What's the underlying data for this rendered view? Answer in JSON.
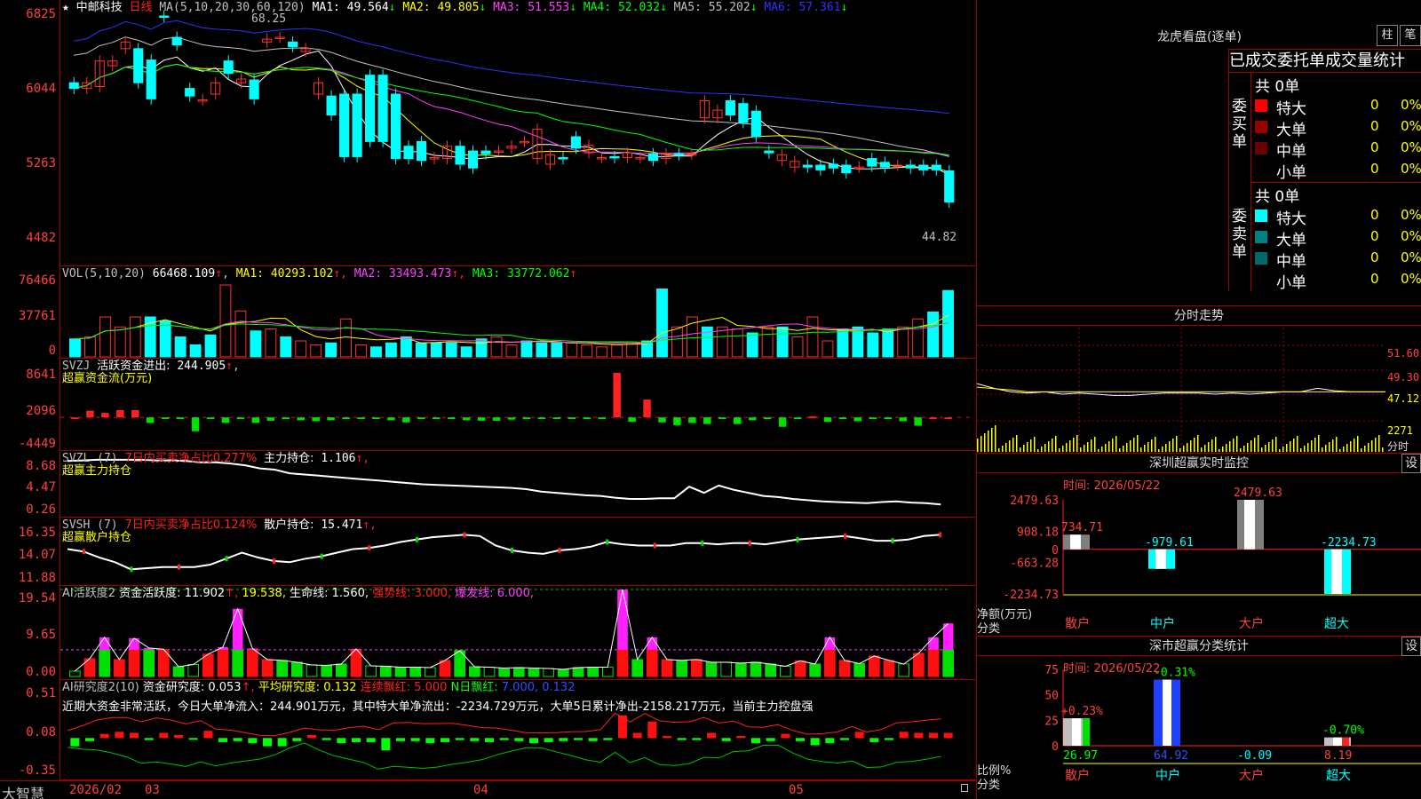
{
  "main": {
    "stock_name": "中邮科技",
    "period": "日线",
    "ma_params": "MA(5,10,20,30,60,120)",
    "ma": [
      {
        "label": "MA1:",
        "value": "49.564",
        "arrow": "↓",
        "color": "#ffffff"
      },
      {
        "label": "MA2:",
        "value": "49.805",
        "arrow": "↓",
        "color": "#ffff00"
      },
      {
        "label": "MA3:",
        "value": "51.553",
        "arrow": "↓",
        "color": "#ff40ff"
      },
      {
        "label": "MA4:",
        "value": "52.032",
        "arrow": "↓",
        "color": "#00ff00"
      },
      {
        "label": "MA5:",
        "value": "55.202",
        "arrow": "↓",
        "color": "#c0c0c0"
      },
      {
        "label": "MA6:",
        "value": "57.361",
        "arrow": "↓",
        "color": "#3030ff"
      }
    ],
    "y_ticks": [
      "6825",
      "6044",
      "5263",
      "4482"
    ],
    "high_label": "68.25",
    "low_label": "44.82"
  },
  "vol": {
    "header": "VOL(5,10,20)",
    "value": "66468.109",
    "arrow": "↑",
    "ma": [
      {
        "label": "MA1:",
        "value": "40293.102",
        "arrow": "↑",
        "color": "#ffff00"
      },
      {
        "label": "MA2:",
        "value": "33493.473",
        "arrow": "↑",
        "color": "#ff40ff"
      },
      {
        "label": "MA3:",
        "value": "33772.062",
        "arrow": "↑",
        "color": "#00ff00"
      }
    ],
    "y_ticks": [
      "76466",
      "37761",
      "0"
    ]
  },
  "svzj": {
    "header": "SVZJ",
    "label": "活跃资金进出:",
    "value": "244.905",
    "arrow": "↑",
    "sub": "超赢资金流(万元)",
    "y_ticks": [
      "8641",
      "2096",
      "-4449"
    ]
  },
  "svzl": {
    "header": "SVZL (7)",
    "label1": "7日内买卖净占比0.277%",
    "label2": "主力持仓:",
    "value": "1.106",
    "arrow": "↑,",
    "sub": "超赢主力持仓",
    "y_ticks": [
      "8.68",
      "4.47",
      "0.26"
    ]
  },
  "svsh": {
    "header": "SVSH (7)",
    "label1": "7日内买卖净占比0.124%",
    "label2": "散户持仓:",
    "value": "15.471",
    "arrow": "↑,",
    "sub": "超赢散户持仓",
    "y_ticks": [
      "16.35",
      "14.07",
      "11.88"
    ]
  },
  "ai_active": {
    "header": "AI活跃度2",
    "label": "资金活跃度:",
    "value": "11.902",
    "arrow": "↑,",
    "v2": "19.538,",
    "life_label": "生命线:",
    "life_value": "1.560,",
    "strong_label": "强势线:",
    "strong_value": "3.000,",
    "burst_label": "爆发线:",
    "burst_value": "6.000,",
    "y_ticks": [
      "19.54",
      "9.65",
      "0.00"
    ]
  },
  "ai_research": {
    "header": "AI研究度2(10)",
    "label": "资金研究度:",
    "value": "0.053",
    "arrow": "↑,",
    "avg_label": "平均研究度:",
    "avg_value": "0.132",
    "red_label": "连续飘红:",
    "red_value": "5.000",
    "n_label": "N日飘红:",
    "n_value": "7.000, 0.132",
    "note": "近期大资金非常活跃，今日大单净流入：244.901万元，其中特大单净流出：-2234.729万元，大单5日累计净出-2158.217万元，当前主力控盘强",
    "y_ticks": [
      "0.51",
      "0.08",
      "-0.35"
    ]
  },
  "bottom": {
    "brand": "大智慧",
    "dates": [
      "2026/02",
      "03",
      "04",
      "05"
    ]
  },
  "lhb": {
    "title": "龙虎看盘(逐单)",
    "btn1": "柱",
    "btn2": "笔",
    "heading": "已成交委托单成交量统计",
    "buy_label": "委买单",
    "sell_label": "委卖单",
    "buy_total": "共 0单",
    "sell_total": "共 0单",
    "buy_rows": [
      {
        "name": "特大",
        "n": "0",
        "p": "0%",
        "color": "#ff0000"
      },
      {
        "name": "大单",
        "n": "0",
        "p": "0%",
        "color": "#9a0000"
      },
      {
        "name": "中单",
        "n": "0",
        "p": "0%",
        "color": "#6a0000"
      },
      {
        "name": "小单",
        "n": "0",
        "p": "0%",
        "color": ""
      }
    ],
    "sell_rows": [
      {
        "name": "特大",
        "n": "0",
        "p": "0%",
        "color": "#00ffff"
      },
      {
        "name": "大单",
        "n": "0",
        "p": "0%",
        "color": "#008080"
      },
      {
        "name": "中单",
        "n": "0",
        "p": "0%",
        "color": "#006a6a"
      },
      {
        "name": "小单",
        "n": "0",
        "p": "0%",
        "color": ""
      }
    ]
  },
  "intraday": {
    "title": "分时走势",
    "ticks": [
      "51.60",
      "49.30",
      "47.12",
      "2271",
      "分时"
    ]
  },
  "sz_monitor": {
    "title": "深圳超赢实时监控",
    "set": "设",
    "time": "时间: 2026/05/22",
    "y_ticks": [
      "2479.63",
      "908.18",
      "0",
      "-663.28",
      "-2234.73"
    ],
    "ylabel": "净额(万元)",
    "xlabel": "分类",
    "categories": [
      "散户",
      "中户",
      "大户",
      "超大"
    ],
    "values": [
      "734.71",
      "-979.61",
      "2479.63",
      "-2234.73"
    ]
  },
  "sz_class": {
    "title": "深市超赢分类统计",
    "set": "设",
    "time": "时间: 2026/05/22",
    "y_ticks": [
      "75",
      "50",
      "25",
      "0"
    ],
    "ylabel": "比例%",
    "xlabel": "分类",
    "categories": [
      "散户",
      "中户",
      "大户",
      "超大"
    ],
    "bar_labels": [
      "+0.23%",
      "-0.31%",
      "",
      "-0.70%"
    ],
    "values": [
      "26.97",
      "64.92",
      "-0.09",
      "8.19"
    ]
  },
  "chart_data": [
    {
      "type": "candlestick",
      "title": "中邮科技 日线",
      "x_labels": [
        "2026/02",
        "03",
        "04",
        "05"
      ],
      "ylim": [
        44.82,
        68.25
      ],
      "open": [
        61.2,
        60.6,
        60.8,
        63.0,
        64.8,
        64.8,
        63.6,
        68.25,
        66.0,
        60.6,
        59.4,
        60.0,
        63.5,
        61.2,
        61.5,
        65.5,
        66.0,
        65.5,
        64.5,
        60.0,
        59.8,
        60.0,
        60.0,
        62.0,
        62.0,
        60.0,
        54.5,
        55.0,
        53.2,
        53.2,
        54.5,
        54.0,
        54.0,
        54.0,
        54.3,
        55.0,
        53.2,
        52.6,
        53.3,
        55.5,
        53.8,
        53.3,
        53.4,
        53.3,
        53.3,
        53.7,
        53.2,
        53.7,
        53.7,
        57.5,
        57.5,
        59.3,
        59.0,
        58.2,
        54.0,
        53.0,
        52.3,
        52.5,
        52.5,
        52.6,
        52.5,
        52.3,
        53.2,
        52.8,
        52.5,
        52.5,
        52.5,
        52.5,
        51.9
      ],
      "close": [
        60.6,
        61.2,
        63.5,
        63.5,
        65.5,
        61.2,
        59.5,
        68.2,
        65.2,
        59.8,
        59.4,
        61.2,
        62.2,
        61.6,
        59.5,
        65.8,
        66.0,
        65.0,
        64.8,
        61.2,
        57.8,
        53.4,
        53.4,
        55.0,
        55.0,
        53.2,
        53.2,
        53.0,
        53.3,
        54.5,
        52.6,
        52.2,
        53.7,
        54.0,
        54.5,
        55.0,
        56.3,
        53.6,
        53.2,
        54.3,
        54.6,
        53.3,
        53.3,
        53.8,
        53.3,
        53.0,
        53.7,
        53.6,
        53.7,
        59.3,
        58.3,
        57.8,
        57.0,
        55.5,
        53.8,
        53.6,
        52.9,
        52.3,
        52.0,
        52.2,
        51.7,
        52.3,
        52.4,
        52.3,
        52.5,
        52.2,
        52.0,
        52.0,
        48.6
      ]
    },
    {
      "type": "bar",
      "title": "VOL(5,10,20)",
      "ylim": [
        0,
        76466
      ],
      "values": [
        18000,
        20000,
        40000,
        30000,
        40000,
        40000,
        36000,
        20000,
        12000,
        22000,
        72000,
        46000,
        26000,
        28000,
        20000,
        16000,
        12000,
        14000,
        38000,
        12000,
        10000,
        14000,
        20000,
        14000,
        14000,
        14000,
        10000,
        18000,
        20000,
        12000,
        16000,
        14000,
        14000,
        14000,
        12000,
        10000,
        12000,
        15000,
        16000,
        68000,
        30000,
        40000,
        30000,
        30000,
        28000,
        24000,
        30000,
        30000,
        20000,
        40000,
        16000,
        28000,
        30000,
        24000,
        28000,
        30000,
        38000,
        45000,
        66468
      ]
    },
    {
      "type": "bar",
      "title": "超赢资金流(万元)",
      "ylim": [
        -4449,
        8641
      ],
      "values": [
        0,
        1200,
        800,
        1300,
        1300,
        -1000,
        -300,
        -200,
        -2500,
        -300,
        -1000,
        -300,
        -1000,
        -600,
        -200,
        -500,
        -700,
        -500,
        -300,
        -300,
        -100,
        -500,
        -900,
        -300,
        -200,
        -200,
        -500,
        -600,
        -600,
        -400,
        -300,
        -300,
        -200,
        -200,
        -200,
        -300,
        8000,
        -800,
        3200,
        -900,
        -1400,
        -1000,
        -1200,
        -200,
        -1200,
        -500,
        -300,
        -1700,
        -300,
        200,
        -800,
        -200,
        -700,
        -300,
        -300,
        -700,
        -1500,
        0,
        0
      ]
    },
    {
      "type": "line",
      "title": "超赢主力持仓",
      "ylim": [
        0.26,
        8.68
      ],
      "values": [
        8.2,
        8.3,
        8.4,
        8.4,
        8.4,
        8.4,
        8.3,
        8.3,
        8.2,
        8.0,
        8.0,
        7.8,
        7.5,
        7.0,
        6.8,
        6.2,
        6.0,
        5.8,
        5.6,
        5.4,
        5.2,
        5.0,
        4.8,
        4.6,
        4.4,
        4.3,
        4.2,
        4.1,
        4.0,
        3.9,
        3.8,
        3.6,
        3.2,
        3.0,
        2.8,
        2.6,
        2.5,
        2.2,
        2.0,
        2.0,
        2.1,
        2.1,
        4.0,
        3.0,
        4.2,
        3.5,
        3.0,
        2.5,
        2.3,
        2.0,
        1.8,
        1.6,
        1.5,
        1.4,
        1.3,
        1.5,
        1.6,
        1.4,
        1.3,
        1.1
      ]
    },
    {
      "type": "line",
      "title": "超赢散户持仓",
      "ylim": [
        11.88,
        16.35
      ],
      "values": [
        14.3,
        14.1,
        13.6,
        13.2,
        12.6,
        12.7,
        12.8,
        12.8,
        12.8,
        13.0,
        13.5,
        14.0,
        13.6,
        13.3,
        13.2,
        13.5,
        13.7,
        14.0,
        14.3,
        14.4,
        14.6,
        14.9,
        15.1,
        15.3,
        15.4,
        15.5,
        15.4,
        14.6,
        14.2,
        14.0,
        13.9,
        14.2,
        14.3,
        14.5,
        14.9,
        14.7,
        14.6,
        14.6,
        14.6,
        14.8,
        14.8,
        14.7,
        14.8,
        14.8,
        14.7,
        14.9,
        15.1,
        15.2,
        15.3,
        15.4,
        15.2,
        15.0,
        15.0,
        15.1,
        15.4,
        15.5
      ]
    },
    {
      "type": "bar",
      "title": "AI活跃度2",
      "ylim": [
        0,
        19.54
      ],
      "values": [
        1.2,
        4.0,
        8.8,
        3.8,
        8.6,
        6.4,
        6.1,
        2.2,
        2.7,
        5.0,
        6.6,
        15.2,
        6.3,
        3.8,
        3.6,
        3.2,
        2.6,
        2.5,
        2.8,
        6.2,
        2.4,
        2.3,
        2.1,
        2.1,
        2.0,
        3.6,
        5.8,
        2.2,
        2.1,
        1.9,
        2.0,
        1.9,
        1.8,
        1.6,
        2.0,
        2.1,
        2.1,
        19.5,
        3.8,
        8.8,
        3.8,
        3.6,
        3.8,
        3.2,
        3.2,
        3.0,
        3.2,
        2.8,
        2.3,
        3.5,
        2.8,
        8.8,
        3.6,
        2.9,
        4.6,
        3.6,
        2.8,
        5.2,
        8.8,
        11.9
      ]
    },
    {
      "type": "bar",
      "title": "AI研究度2(10)",
      "ylim": [
        -0.35,
        0.51
      ],
      "values": [
        -0.08,
        -0.03,
        0.04,
        0.06,
        0.05,
        -0.02,
        0.05,
        0.03,
        -0.01,
        0.07,
        -0.04,
        -0.03,
        -0.05,
        -0.08,
        -0.08,
        -0.03,
        0.03,
        -0.02,
        -0.05,
        -0.04,
        -0.04,
        -0.12,
        -0.03,
        -0.03,
        -0.05,
        -0.04,
        -0.02,
        -0.03,
        -0.04,
        -0.02,
        -0.03,
        -0.05,
        -0.04,
        -0.03,
        -0.02,
        -0.03,
        -0.02,
        0.22,
        0.05,
        0.16,
        0.02,
        -0.02,
        -0.02,
        0.05,
        -0.03,
        0.02,
        -0.05,
        -0.03,
        0.04,
        -0.03,
        -0.07,
        -0.05,
        -0.02,
        0.06,
        -0.04,
        -0.02,
        0.06,
        0.05,
        0.05,
        0.05
      ]
    },
    {
      "type": "line",
      "title": "分时走势",
      "ylim": [
        44.82,
        51.6
      ],
      "values": [
        47.6,
        47.2,
        46.9,
        46.8,
        46.9,
        46.7,
        46.8,
        46.7,
        46.6,
        46.6,
        46.7,
        46.8,
        46.8,
        46.8,
        46.7,
        46.8,
        46.7,
        46.8,
        46.9,
        46.9,
        47.2,
        47.0,
        46.9,
        46.9,
        46.9
      ]
    },
    {
      "type": "bar",
      "title": "深圳超赢实时监控",
      "categories": [
        "散户",
        "中户",
        "大户",
        "超大"
      ],
      "values": [
        734.71,
        -979.61,
        2479.63,
        -2234.73
      ],
      "ylim": [
        -2234.73,
        2479.63
      ]
    },
    {
      "type": "bar",
      "title": "深市超赢分类统计",
      "categories": [
        "散户",
        "中户",
        "大户",
        "超大"
      ],
      "values": [
        26.97,
        64.92,
        -0.09,
        8.19
      ],
      "ylim": [
        0,
        75
      ]
    }
  ]
}
